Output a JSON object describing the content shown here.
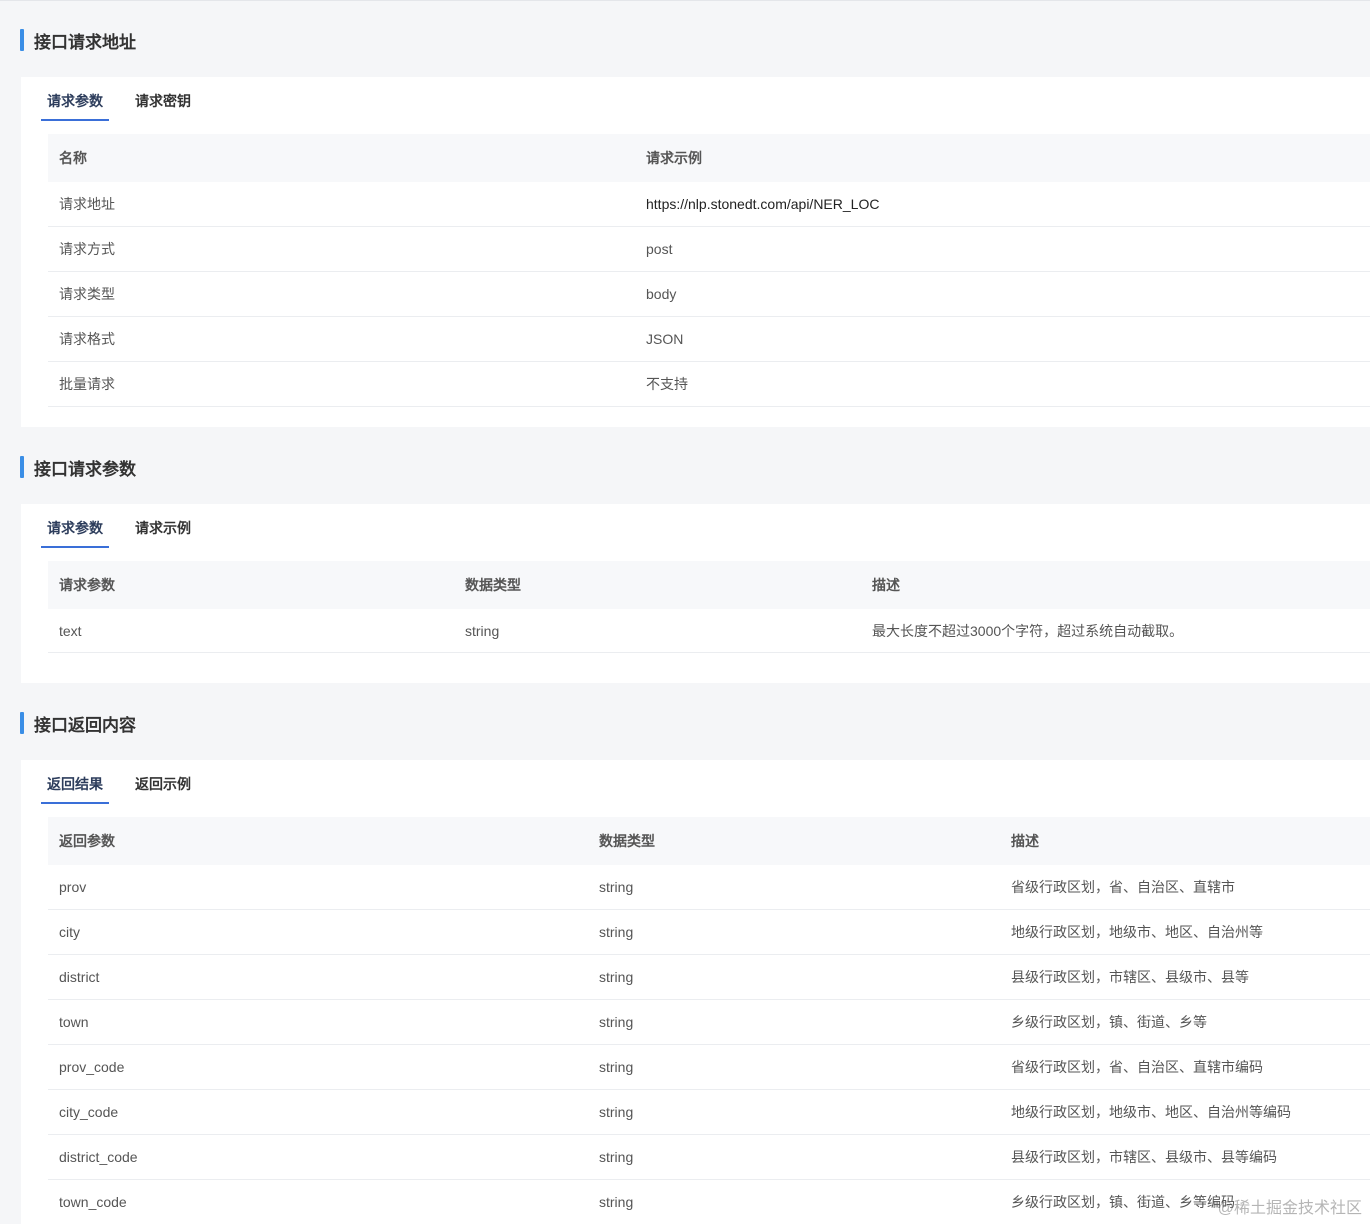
{
  "section1": {
    "title": "接口请求地址",
    "tabs": [
      "请求参数",
      "请求密钥"
    ],
    "headers": [
      "名称",
      "请求示例"
    ],
    "rows": [
      [
        "请求地址",
        "https://nlp.stonedt.com/api/NER_LOC"
      ],
      [
        "请求方式",
        "post"
      ],
      [
        "请求类型",
        "body"
      ],
      [
        "请求格式",
        "JSON"
      ],
      [
        "批量请求",
        "不支持"
      ]
    ]
  },
  "section2": {
    "title": "接口请求参数",
    "tabs": [
      "请求参数",
      "请求示例"
    ],
    "headers": [
      "请求参数",
      "数据类型",
      "描述"
    ],
    "rows": [
      [
        "text",
        "string",
        "最大长度不超过3000个字符，超过系统自动截取。"
      ]
    ]
  },
  "section3": {
    "title": "接口返回内容",
    "tabs": [
      "返回结果",
      "返回示例"
    ],
    "headers": [
      "返回参数",
      "数据类型",
      "描述"
    ],
    "rows": [
      [
        "prov",
        "string",
        "省级行政区划，省、自治区、直辖市"
      ],
      [
        "city",
        "string",
        "地级行政区划，地级市、地区、自治州等"
      ],
      [
        "district",
        "string",
        "县级行政区划，市辖区、县级市、县等"
      ],
      [
        "town",
        "string",
        "乡级行政区划，镇、街道、乡等"
      ],
      [
        "prov_code",
        "string",
        "省级行政区划，省、自治区、直辖市编码"
      ],
      [
        "city_code",
        "string",
        "地级行政区划，地级市、地区、自治州等编码"
      ],
      [
        "district_code",
        "string",
        "县级行政区划，市辖区、县级市、县等编码"
      ],
      [
        "town_code",
        "string",
        "乡级行政区划，镇、街道、乡等编码"
      ]
    ]
  },
  "watermark": "@稀土掘金技术社区"
}
